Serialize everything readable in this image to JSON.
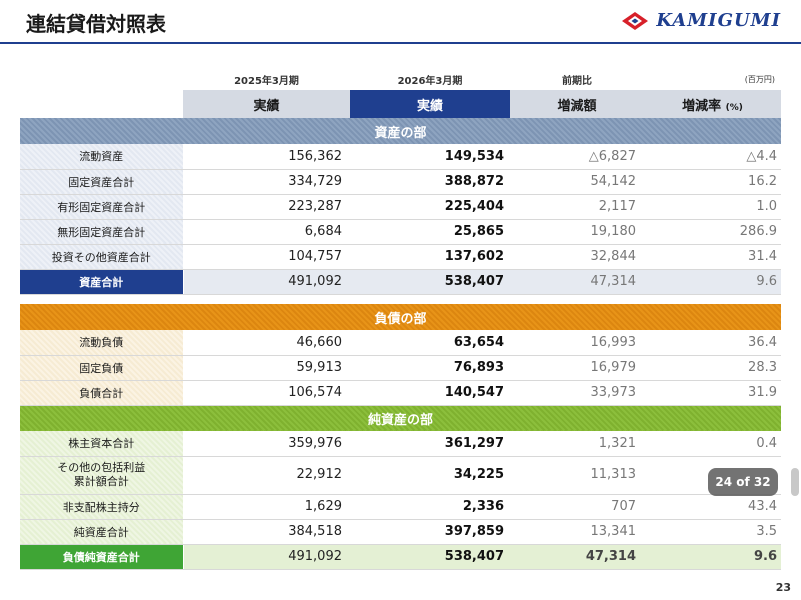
{
  "title": "連結貸借対照表",
  "logo": {
    "text": "KAMIGUMI",
    "icon": "diamond-k-logo"
  },
  "colors": {
    "navy": "#1f3f8f",
    "orange": "#e89418",
    "green": "#3fa535"
  },
  "header": {
    "year_prev": "2025年3月期",
    "year_curr": "2026年3月期",
    "compare": "前期比",
    "unit": "(百万円)",
    "col_prev": "実績",
    "col_curr": "実績",
    "col_diff": "増減額",
    "col_rate": "増減率",
    "col_rate_unit": "(%)"
  },
  "sections": {
    "assets": "資産の部",
    "liabilities": "負債の部",
    "equity": "純資産の部"
  },
  "assets": [
    {
      "label": "流動資産",
      "prev": "156,362",
      "curr": "149,534",
      "diff": "△6,827",
      "rate": "△4.4"
    },
    {
      "label": "固定資産合計",
      "prev": "334,729",
      "curr": "388,872",
      "diff": "54,142",
      "rate": "16.2"
    },
    {
      "label": "有形固定資産合計",
      "prev": "223,287",
      "curr": "225,404",
      "diff": "2,117",
      "rate": "1.0"
    },
    {
      "label": "無形固定資産合計",
      "prev": "6,684",
      "curr": "25,865",
      "diff": "19,180",
      "rate": "286.9"
    },
    {
      "label": "投資その他資産合計",
      "prev": "104,757",
      "curr": "137,602",
      "diff": "32,844",
      "rate": "31.4"
    },
    {
      "label": "資産合計",
      "prev": "491,092",
      "curr": "538,407",
      "diff": "47,314",
      "rate": "9.6"
    }
  ],
  "liabilities": [
    {
      "label": "流動負債",
      "prev": "46,660",
      "curr": "63,654",
      "diff": "16,993",
      "rate": "36.4"
    },
    {
      "label": "固定負債",
      "prev": "59,913",
      "curr": "76,893",
      "diff": "16,979",
      "rate": "28.3"
    },
    {
      "label": "負債合計",
      "prev": "106,574",
      "curr": "140,547",
      "diff": "33,973",
      "rate": "31.9"
    }
  ],
  "equity": [
    {
      "label": "株主資本合計",
      "prev": "359,976",
      "curr": "361,297",
      "diff": "1,321",
      "rate": "0.4"
    },
    {
      "label_line1": "その他の包括利益",
      "label_line2": "累計額合計",
      "prev": "22,912",
      "curr": "34,225",
      "diff": "11,313",
      "rate": ""
    },
    {
      "label": "非支配株主持分",
      "prev": "1,629",
      "curr": "2,336",
      "diff": "707",
      "rate": "43.4"
    },
    {
      "label": "純資産合計",
      "prev": "384,518",
      "curr": "397,859",
      "diff": "13,341",
      "rate": "3.5"
    },
    {
      "label": "負債純資産合計",
      "prev": "491,092",
      "curr": "538,407",
      "diff": "47,314",
      "rate": "9.6"
    }
  ],
  "slide_counter": "24 of 32",
  "page_number": "23"
}
